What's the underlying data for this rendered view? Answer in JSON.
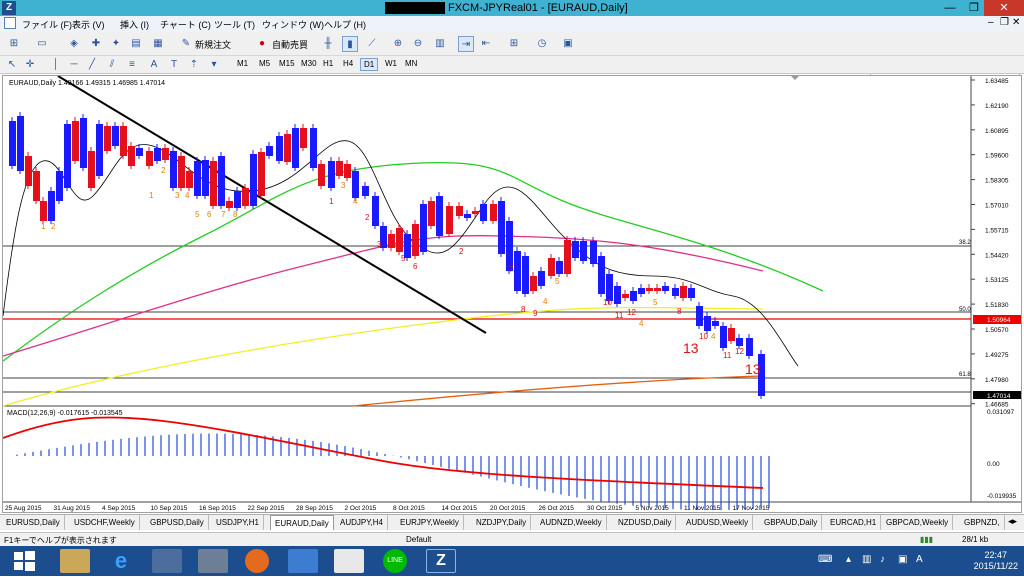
{
  "window": {
    "title": "FXCM-JPYReal01 - [EURAUD,Daily]",
    "minimize": "—",
    "maximize": "❐",
    "close": "✕"
  },
  "menu": [
    "ファイル (F)",
    "表示 (V)",
    "挿入 (I)",
    "チャート (C)",
    "ツール (T)",
    "ウィンドウ (W)",
    "ヘルプ (H)"
  ],
  "mdi_controls": {
    "minimize": "–",
    "restore": "❐",
    "close": "✕"
  },
  "toolbar": {
    "new_order": "新規注文",
    "auto_trade": "自動売買"
  },
  "timeframes": [
    "M1",
    "M5",
    "M15",
    "M30",
    "H1",
    "H4",
    "D1",
    "W1",
    "MN"
  ],
  "selected_timeframe": "D1",
  "chart": {
    "header": "EURAUD,Daily  1.49166 1.49315 1.46985 1.47014",
    "macd_label": "MACD(12,26,9) -0.017615 -0.013545",
    "price_labels": [
      "1.63485",
      "1.62190",
      "1.60895",
      "1.59600",
      "1.58305",
      "1.57010",
      "1.55715",
      "1.54420",
      "1.53125",
      "1.51830",
      "1.50570",
      "1.49275",
      "1.47980",
      "1.46685"
    ],
    "fib_labels": {
      "fib382": "38.2",
      "fib50": "50.0",
      "fib618": "61.8"
    },
    "red_level": "1.50964",
    "current_price": "1.47014",
    "macd_axis": [
      "0.031097",
      "0.00",
      "-0.019935"
    ],
    "date_labels": [
      "25 Aug 2015",
      "31 Aug 2015",
      "4 Sep 2015",
      "10 Sep 2015",
      "16 Sep 2015",
      "22 Sep 2015",
      "28 Sep 2015",
      "2 Oct 2015",
      "8 Oct 2015",
      "14 Oct 2015",
      "20 Oct 2015",
      "26 Oct 2015",
      "30 Oct 2015",
      "5 Nov 2015",
      "11 Nov 2015",
      "17 Nov 2015"
    ],
    "td_counts": [
      {
        "t": "1",
        "c": "orange"
      },
      {
        "t": "2",
        "c": "orange"
      },
      {
        "t": "1",
        "c": "orange"
      },
      {
        "t": "2",
        "c": "orange"
      },
      {
        "t": "3",
        "c": "orange"
      },
      {
        "t": "4",
        "c": "orange"
      },
      {
        "t": "5",
        "c": "orange"
      },
      {
        "t": "6",
        "c": "orange"
      },
      {
        "t": "7",
        "c": "orange"
      },
      {
        "t": "8",
        "c": "orange"
      },
      {
        "t": "1",
        "c": "red"
      },
      {
        "t": "3",
        "c": "orange"
      },
      {
        "t": "4",
        "c": "orange"
      },
      {
        "t": "2",
        "c": "red"
      },
      {
        "t": "3",
        "c": "red"
      },
      {
        "t": "4",
        "c": "red"
      },
      {
        "t": "5",
        "c": "red"
      },
      {
        "t": "6",
        "c": "red"
      },
      {
        "t": "2",
        "c": "red"
      },
      {
        "t": "7",
        "c": "red"
      },
      {
        "t": "8",
        "c": "red"
      },
      {
        "t": "9",
        "c": "red"
      },
      {
        "t": "4",
        "c": "orange"
      },
      {
        "t": "5",
        "c": "orange"
      },
      {
        "t": "10",
        "c": "red"
      },
      {
        "t": "11",
        "c": "red"
      },
      {
        "t": "12",
        "c": "red"
      },
      {
        "t": "4",
        "c": "orange"
      },
      {
        "t": "5",
        "c": "orange"
      },
      {
        "t": "8",
        "c": "red"
      },
      {
        "t": "10",
        "c": "red"
      },
      {
        "t": "4",
        "c": "orange"
      },
      {
        "t": "11",
        "c": "red"
      },
      {
        "t": "12",
        "c": "red"
      },
      {
        "t": "13",
        "c": "red"
      },
      {
        "t": "13",
        "c": "red"
      }
    ]
  },
  "tabs": [
    "EURUSD,Daily",
    "USDCHF,Weekly",
    "GBPUSD,Daily",
    "USDJPY,H1",
    "EURAUD,Daily",
    "AUDJPY,H4",
    "EURJPY,Weekly",
    "NZDJPY,Daily",
    "AUDNZD,Weekly",
    "NZDUSD,Daily",
    "AUDUSD,Weekly",
    "GBPAUD,Daily",
    "EURCAD,H1",
    "GBPCAD,Weekly",
    "GBPNZD,"
  ],
  "active_tab": "EURAUD,Daily",
  "status": {
    "help": "F1キーでヘルプが表示されます",
    "profile": "Default",
    "traffic": "28/1 kb"
  },
  "clock": {
    "time": "22:47",
    "date": "2015/11/22"
  },
  "colors": {
    "bull": "#e4101c",
    "bear": "#1a1aff",
    "ma_green": "#22cc22",
    "ma_magenta": "#e0308a",
    "ma_yellow": "#f0f020",
    "ma_orange": "#e86010"
  }
}
